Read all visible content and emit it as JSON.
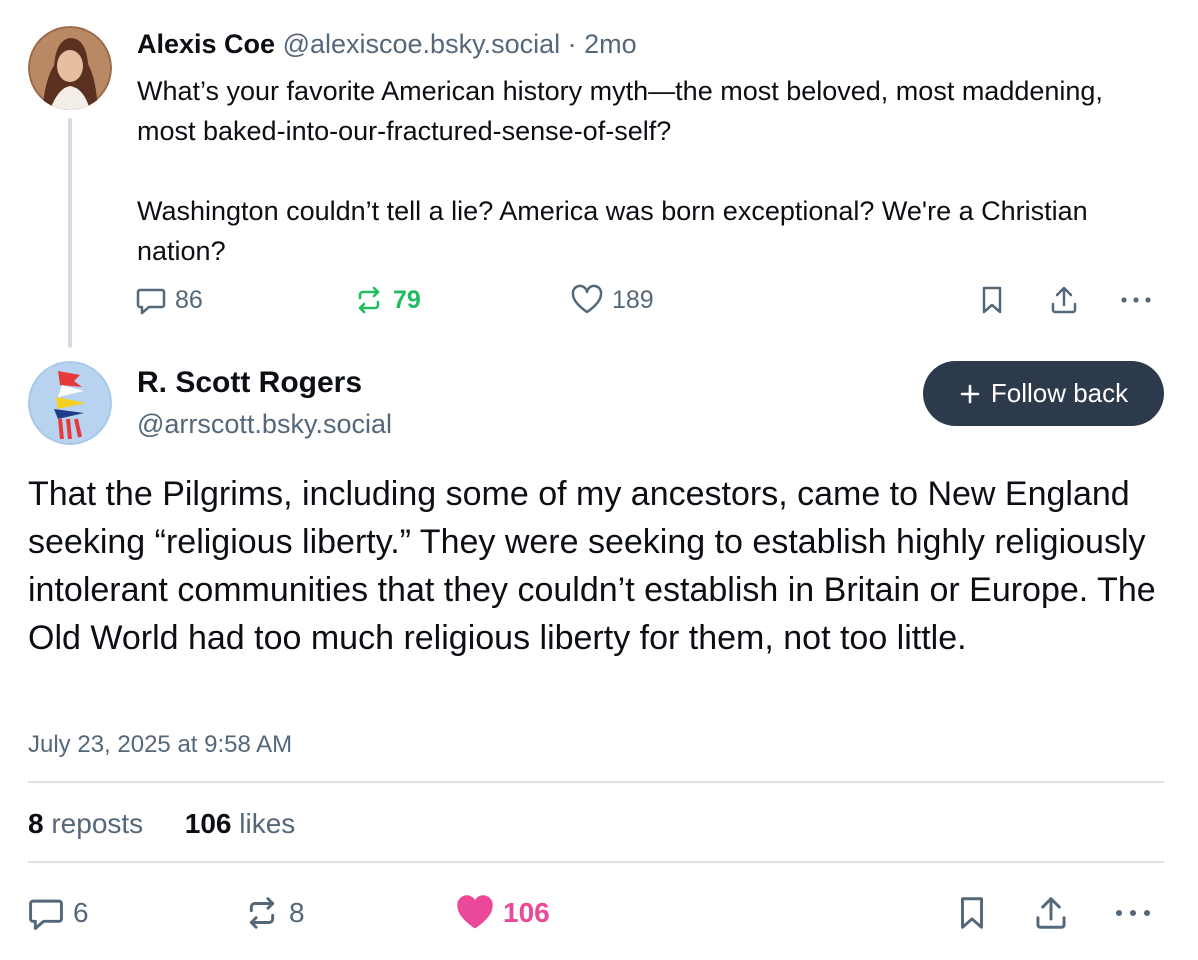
{
  "parent_post": {
    "author_name": "Alexis Coe",
    "author_handle": "@alexiscoe.bsky.social",
    "separator": "·",
    "age": "2mo",
    "text_paragraphs": [
      "What’s your favorite American history myth—the most beloved, most maddening, most baked-into-our-fractured-sense-of-self?",
      "Washington couldn’t tell a lie? America was born exceptional? We're a Christian nation?"
    ],
    "reply_count": "86",
    "repost_count": "79",
    "like_count": "189",
    "repost_color": "#20bc60"
  },
  "reply_post": {
    "author_name": "R. Scott Rogers",
    "author_handle": "@arrscott.bsky.social",
    "follow_button_label": "Follow back",
    "text": "That the Pilgrims, including some of my ancestors, came to New England seeking “religious liberty.” They were seeking to establish highly religiously intolerant communities that they couldn’t establish in Britain or Europe. The Old World had too much religious liberty for them, not too little.",
    "timestamp": "July 23, 2025 at 9:58 AM",
    "stats": {
      "reposts_count": "8",
      "reposts_label": "reposts",
      "likes_count": "106",
      "likes_label": "likes"
    },
    "reply_count": "6",
    "repost_count": "8",
    "like_count": "106",
    "liked": true,
    "like_color": "#ec4899"
  },
  "icons": {
    "reply": "speech-bubble-icon",
    "repost": "repost-arrows-icon",
    "like": "heart-icon",
    "bookmark": "bookmark-icon",
    "share": "share-icon",
    "more": "more-dots-icon",
    "follow": "plus-icon"
  },
  "colors": {
    "text_primary": "#0b0f14",
    "text_muted": "#55687a",
    "button_dark": "#2c3a4b",
    "divider": "#dce2e8"
  }
}
